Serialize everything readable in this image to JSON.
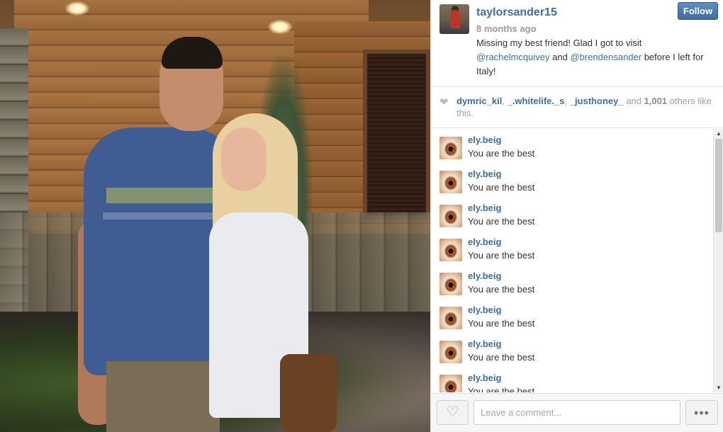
{
  "post": {
    "username": "taylorsander15",
    "time_ago": "8 months ago",
    "follow_label": "Follow",
    "caption": {
      "line1": "Missing my best friend! Glad I got to visit",
      "mention1": "@rachelmcquivey",
      "and_word": " and ",
      "mention2": "@brendensander",
      "tail": " before I left for Italy!"
    }
  },
  "likes": {
    "user1": "dymric_kil",
    "sep1": ", ",
    "user2": "_.whitelife._s",
    "sep2": ", ",
    "user3": "_justhoney_",
    "and_word": " and ",
    "count": "1,001",
    "suffix": " others like this."
  },
  "comments": [
    {
      "user": "ely.beig",
      "text": "You are the best"
    },
    {
      "user": "ely.beig",
      "text": "You are the best"
    },
    {
      "user": "ely.beig",
      "text": "You are the best"
    },
    {
      "user": "ely.beig",
      "text": "You are the best"
    },
    {
      "user": "ely.beig",
      "text": "You are the best"
    },
    {
      "user": "ely.beig",
      "text": "You are the best"
    },
    {
      "user": "ely.beig",
      "text": "You are the best"
    },
    {
      "user": "ely.beig",
      "text": "You are the best"
    }
  ],
  "footer": {
    "comment_placeholder": "Leave a comment...",
    "like_icon": "heart-icon",
    "more_icon": "ellipsis-icon"
  },
  "colors": {
    "link": "#3f6f9c",
    "follow_button": "#4a7aab"
  }
}
